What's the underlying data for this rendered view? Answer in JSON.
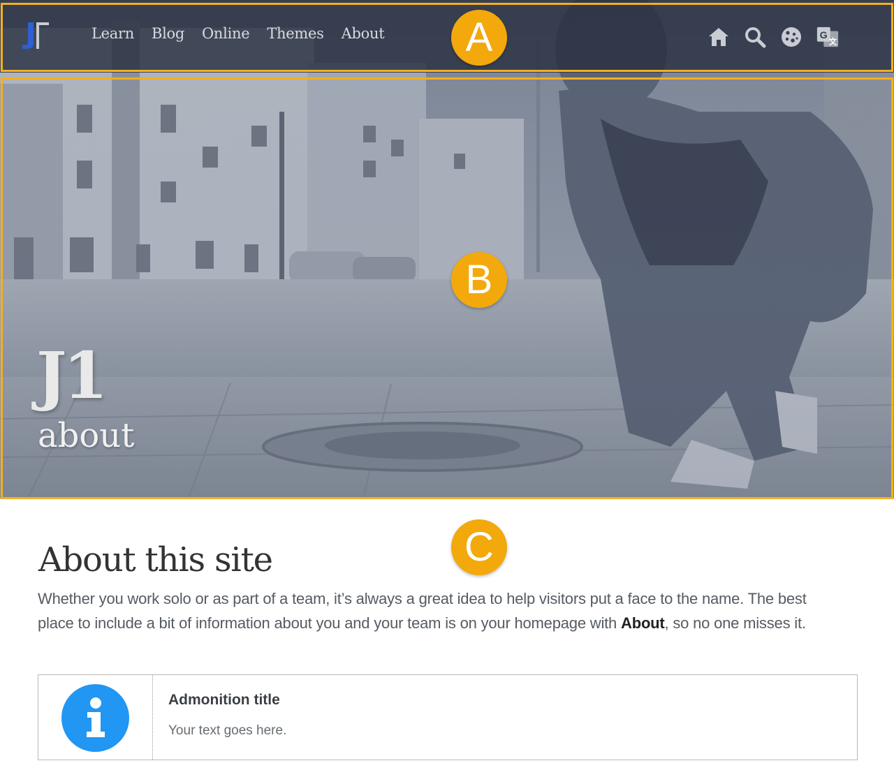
{
  "header": {
    "nav": [
      "Learn",
      "Blog",
      "Online",
      "Themes",
      "About"
    ],
    "icons": [
      "home-icon",
      "search-icon",
      "cookie-icon",
      "translate-icon"
    ]
  },
  "banner": {
    "title": "J1",
    "tagline": "about"
  },
  "markers": {
    "a": "A",
    "b": "B",
    "c": "C"
  },
  "content": {
    "title": "About this site",
    "intro_before": "Whether you work solo or as part of a team, it’s always a great idea to help visitors put a face to the name. The best place to include a bit of information about you and your team is on your homepage with ",
    "intro_bold": "About",
    "intro_after": ", so no one misses it.",
    "admonition": {
      "title": "Admonition title",
      "text": "Your text goes here.",
      "icon": "info-icon"
    }
  },
  "colors": {
    "highlight": "#f3b01c",
    "marker": "#f3a80c",
    "info": "#2196f3",
    "logo": "#2f5fd0"
  }
}
